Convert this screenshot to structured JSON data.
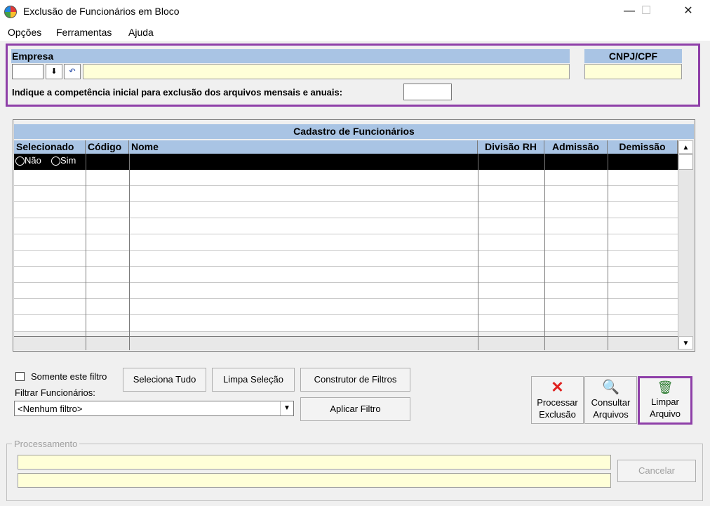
{
  "window": {
    "title": "Exclusão de Funcionários em Bloco",
    "minimize": "—",
    "maximize": "☐",
    "close": "✕"
  },
  "menu": [
    "Opções",
    "Ferramentas",
    "Ajuda"
  ],
  "empresa": {
    "label": "Empresa",
    "code_value": "",
    "name_value": "",
    "dropdown_glyph": "⬇",
    "undo_glyph": "↶",
    "cnpj_label": "CNPJ/CPF",
    "cnpj_value": "",
    "competencia_label": "Indique a competência inicial para exclusão dos arquivos mensais e anuais:",
    "competencia_value": ""
  },
  "grid": {
    "title": "Cadastro de Funcionários",
    "columns": [
      "Selecionado",
      "Código",
      "Nome",
      "Divisão RH",
      "Admissão",
      "Demissão"
    ],
    "first_row": {
      "radio_nao": "Não",
      "radio_sim": "Sim"
    },
    "scroll_up": "▲",
    "scroll_down": "▼"
  },
  "filter": {
    "checkbox_label": "Somente este filtro",
    "checked": false,
    "filtrar_label": "Filtrar Funcionários:",
    "select_value": "<Nenhum filtro>",
    "select_arrow": "▼",
    "seleciona_tudo": "Seleciona Tudo",
    "limpa_selecao": "Limpa Seleção",
    "construtor": "Construtor de Filtros",
    "aplicar": "Aplicar Filtro"
  },
  "actions": {
    "processar_line1": "Processar",
    "processar_line2": "Exclusão",
    "consultar_line1": "Consultar",
    "consultar_line2": "Arquivos",
    "limpar_line1": "Limpar",
    "limpar_line2": "Arquivo",
    "processar_icon": "✕",
    "consultar_icon": "🔍",
    "limpar_icon": "🗑"
  },
  "processamento": {
    "label": "Processamento",
    "line1": "",
    "line2": "",
    "cancelar": "Cancelar"
  },
  "colors": {
    "header_blue": "#a9c4e4",
    "field_yellow": "#ffffd8",
    "highlight_purple": "#8e3fa8",
    "error_red": "#e0201e"
  }
}
